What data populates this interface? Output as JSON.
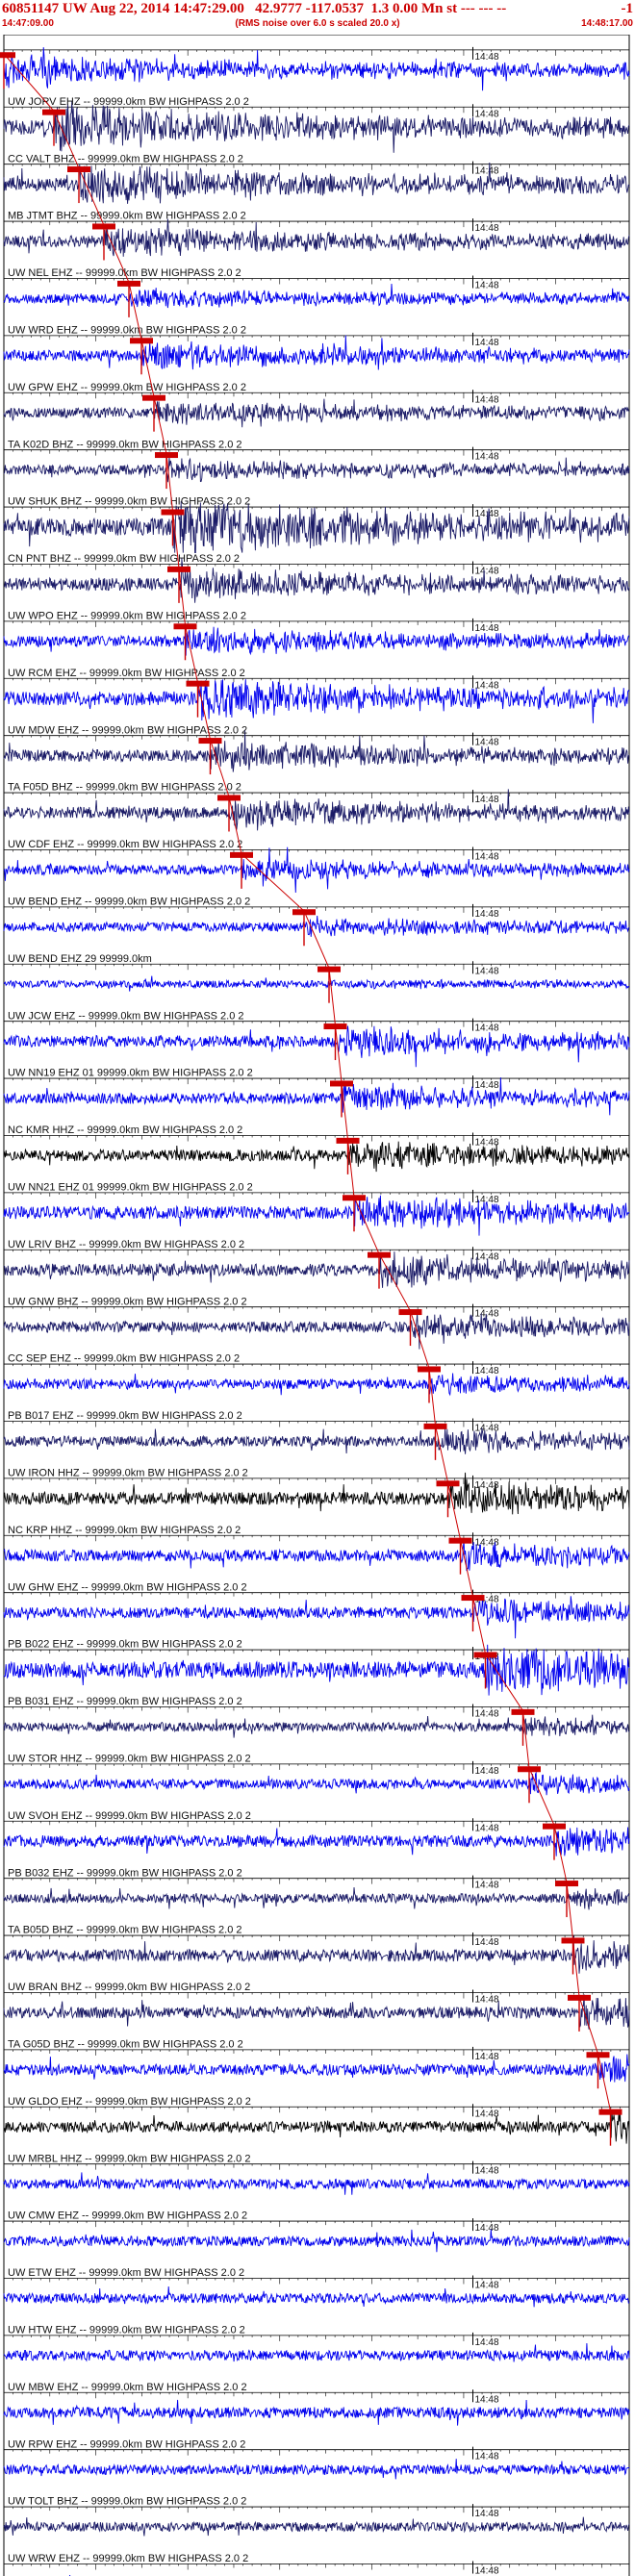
{
  "header": {
    "title": "60851147 UW Aug 22, 2014 14:47:29.00   42.9777 -117.0537  1.3 0.00 Mn st --- --- --",
    "right_mark": "-1",
    "subtitle": "(RMS noise over 6.0 s scaled 20.0 x)",
    "start_time": "14:47:09.00",
    "end_time": "14:48:17.00"
  },
  "colors": {
    "accent": "#cc0000",
    "trace_blue": "#0000ee",
    "trace_navy": "#1a1a66",
    "trace_black": "#000000"
  },
  "chart_data": {
    "type": "seismogram-record-section",
    "time_axis": {
      "start": "14:47:09.00",
      "end": "14:48:17.00",
      "mid_label": "14:48"
    },
    "traces": [
      {
        "label": "",
        "color": "blue",
        "amp": 0.5,
        "pick": 0.0
      },
      {
        "label": "UW JORV EHZ -- 99999.0km BW  HIGHPASS  2.0  2",
        "color": "navy",
        "amp": 0.8,
        "pick": 0.08
      },
      {
        "label": "CC VALT BHZ -- 99999.0km BW  HIGHPASS  2.0  2",
        "color": "navy",
        "amp": 0.7,
        "pick": 0.12
      },
      {
        "label": "MB JTMT BHZ -- 99999.0km BW  HIGHPASS  2.0  2",
        "color": "navy",
        "amp": 0.5,
        "pick": 0.16
      },
      {
        "label": "UW NEL EHZ -- 99999.0km BW  HIGHPASS  2.0  2",
        "color": "blue",
        "amp": 0.3,
        "pick": 0.2
      },
      {
        "label": "UW WRD EHZ -- 99999.0km BW  HIGHPASS  2.0  2",
        "color": "blue",
        "amp": 0.45,
        "pick": 0.22
      },
      {
        "label": "UW GPW EHZ -- 99999.0km BW  HIGHPASS  2.0  2",
        "color": "navy",
        "amp": 0.4,
        "pick": 0.24
      },
      {
        "label": "TA K02D BHZ -- 99999.0km BW  HIGHPASS  2.0  2",
        "color": "navy",
        "amp": 0.35,
        "pick": 0.26
      },
      {
        "label": "UW SHUK BHZ -- 99999.0km BW  HIGHPASS  2.0  2",
        "color": "navy",
        "amp": 1.0,
        "pick": 0.27
      },
      {
        "label": "CN PNT BHZ -- 99999.0km BW  HIGHPASS  2.0  2",
        "color": "navy",
        "amp": 0.6,
        "pick": 0.28
      },
      {
        "label": "UW WPO EHZ -- 99999.0km BW  HIGHPASS  2.0  2",
        "color": "blue",
        "amp": 0.45,
        "pick": 0.29
      },
      {
        "label": "UW RCM EHZ -- 99999.0km BW  HIGHPASS  2.0  2",
        "color": "blue",
        "amp": 0.7,
        "pick": 0.31
      },
      {
        "label": "UW MDW EHZ -- 99999.0km BW  HIGHPASS  2.0  2",
        "color": "navy",
        "amp": 0.5,
        "pick": 0.33
      },
      {
        "label": "TA F05D BHZ -- 99999.0km BW  HIGHPASS  2.0  2",
        "color": "navy",
        "amp": 0.5,
        "pick": 0.36
      },
      {
        "label": "UW CDF EHZ -- 99999.0km BW  HIGHPASS  2.0  2",
        "color": "blue",
        "amp": 0.35,
        "pick": 0.38
      },
      {
        "label": "UW BEND EHZ -- 99999.0km BW  HIGHPASS  2.0  2",
        "color": "blue",
        "amp": 0.3,
        "pick": 0.48
      },
      {
        "label": "UW BEND EHZ 29 99999.0km",
        "color": "blue",
        "amp": 0.1,
        "pick": 0.52
      },
      {
        "label": "UW JCW EHZ -- 99999.0km BW  HIGHPASS  2.0  2",
        "color": "blue",
        "amp": 0.5,
        "pick": 0.53
      },
      {
        "label": "UW NN19 EHZ 01 99999.0km BW  HIGHPASS  2.0  2",
        "color": "blue",
        "amp": 0.45,
        "pick": 0.54
      },
      {
        "label": "NC KMR HHZ -- 99999.0km BW  HIGHPASS  2.0  2",
        "color": "black",
        "amp": 0.5,
        "pick": 0.55
      },
      {
        "label": "UW NN21 EHZ 01 99999.0km BW  HIGHPASS  2.0  2",
        "color": "blue",
        "amp": 0.6,
        "pick": 0.56
      },
      {
        "label": "UW LRIV BHZ -- 99999.0km BW  HIGHPASS  2.0  2",
        "color": "navy",
        "amp": 0.55,
        "pick": 0.6
      },
      {
        "label": "UW GNW BHZ -- 99999.0km BW  HIGHPASS  2.0  2",
        "color": "navy",
        "amp": 0.45,
        "pick": 0.65
      },
      {
        "label": "CC SEP EHZ -- 99999.0km BW  HIGHPASS  2.0  2",
        "color": "blue",
        "amp": 0.35,
        "pick": 0.68
      },
      {
        "label": "PB B017 EHZ -- 99999.0km BW  HIGHPASS  2.0  2",
        "color": "navy",
        "amp": 0.4,
        "pick": 0.69
      },
      {
        "label": "UW IRON HHZ -- 99999.0km BW  HIGHPASS  2.0  2",
        "color": "black",
        "amp": 0.6,
        "pick": 0.71
      },
      {
        "label": "NC KRP HHZ -- 99999.0km BW  HIGHPASS  2.0  2",
        "color": "blue",
        "amp": 0.5,
        "pick": 0.73
      },
      {
        "label": "UW GHW EHZ -- 99999.0km BW  HIGHPASS  2.0  2",
        "color": "blue",
        "amp": 0.45,
        "pick": 0.75
      },
      {
        "label": "PB B022 EHZ -- 99999.0km BW  HIGHPASS  2.0  2",
        "color": "blue",
        "amp": 0.9,
        "pick": 0.77
      },
      {
        "label": "PB B031 EHZ -- 99999.0km BW  HIGHPASS  2.0  2",
        "color": "navy",
        "amp": 0.3,
        "pick": 0.83
      },
      {
        "label": "UW STOR HHZ -- 99999.0km BW  HIGHPASS  2.0  2",
        "color": "blue",
        "amp": 0.35,
        "pick": 0.84
      },
      {
        "label": "UW SVOH EHZ -- 99999.0km BW  HIGHPASS  2.0  2",
        "color": "blue",
        "amp": 0.5,
        "pick": 0.88
      },
      {
        "label": "PB B032 EHZ -- 99999.0km BW  HIGHPASS  2.0  2",
        "color": "navy",
        "amp": 0.3,
        "pick": 0.9
      },
      {
        "label": "TA B05D BHZ -- 99999.0km BW  HIGHPASS  2.0  2",
        "color": "navy",
        "amp": 0.55,
        "pick": 0.91
      },
      {
        "label": "UW BRAN BHZ -- 99999.0km BW  HIGHPASS  2.0  2",
        "color": "navy",
        "amp": 0.5,
        "pick": 0.92
      },
      {
        "label": "TA G05D BHZ -- 99999.0km BW  HIGHPASS  2.0  2",
        "color": "blue",
        "amp": 0.45,
        "pick": 0.95
      },
      {
        "label": "UW GLDO EHZ -- 99999.0km BW  HIGHPASS  2.0  2",
        "color": "black",
        "amp": 0.45,
        "pick": 0.97
      },
      {
        "label": "UW MRBL HHZ -- 99999.0km BW  HIGHPASS  2.0  2",
        "color": "blue",
        "amp": 0.35,
        "pick": null
      },
      {
        "label": "UW CMW EHZ -- 99999.0km BW  HIGHPASS  2.0  2",
        "color": "blue",
        "amp": 0.35,
        "pick": null
      },
      {
        "label": "UW ETW EHZ -- 99999.0km BW  HIGHPASS  2.0  2",
        "color": "blue",
        "amp": 0.35,
        "pick": null
      },
      {
        "label": "UW HTW EHZ -- 99999.0km BW  HIGHPASS  2.0  2",
        "color": "blue",
        "amp": 0.4,
        "pick": null
      },
      {
        "label": "UW MBW EHZ -- 99999.0km BW  HIGHPASS  2.0  2",
        "color": "blue",
        "amp": 0.45,
        "pick": null
      },
      {
        "label": "UW RPW EHZ -- 99999.0km BW  HIGHPASS  2.0  2",
        "color": "blue",
        "amp": 0.35,
        "pick": null
      },
      {
        "label": "UW TOLT BHZ -- 99999.0km BW  HIGHPASS  2.0  2",
        "color": "navy",
        "amp": 0.3,
        "pick": null
      },
      {
        "label": "UW WRW EHZ -- 99999.0km BW  HIGHPASS  2.0  2",
        "color": "blue",
        "amp": 0.3,
        "pick": null
      }
    ]
  }
}
